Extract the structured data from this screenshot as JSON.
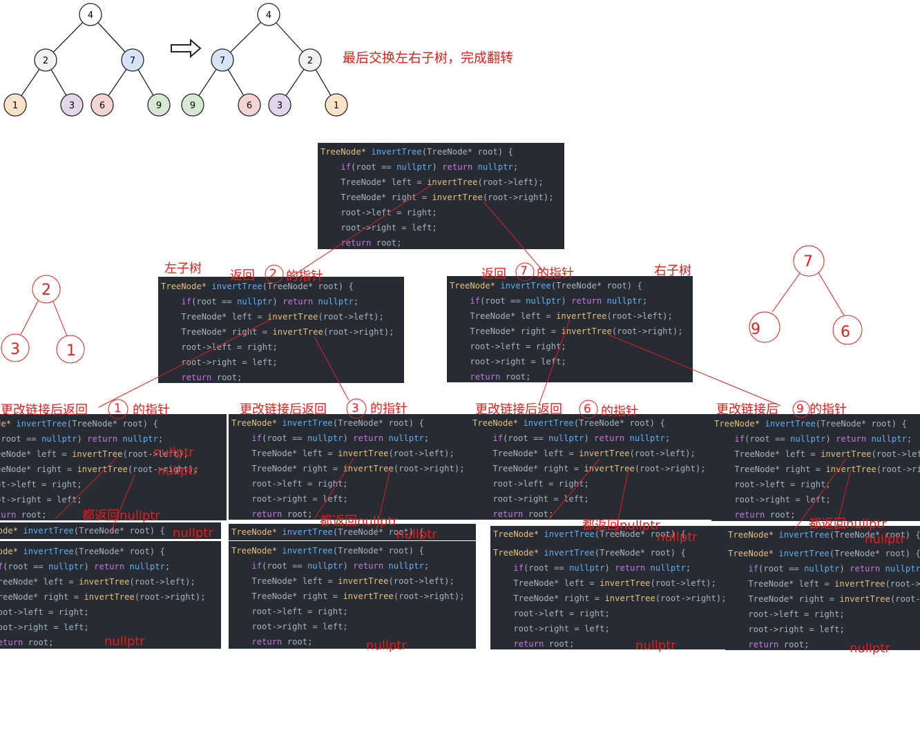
{
  "tree_before": {
    "root": "4",
    "left": "2",
    "right": "7",
    "ll": "1",
    "lr": "3",
    "rl": "6",
    "rr": "9"
  },
  "tree_after": {
    "root": "4",
    "left": "7",
    "right": "2",
    "ll": "9",
    "lr": "6",
    "rl": "3",
    "rr": "1"
  },
  "arrow_icon": "right-arrow-icon",
  "final_note": "最后交换左右子树，完成翻转",
  "code": {
    "l1": [
      "TreeNode* ",
      "invertTree",
      "(TreeNode* root) {"
    ],
    "l2": [
      "    ",
      "if",
      "(root == ",
      "nullptr",
      ") ",
      "return",
      " ",
      "nullptr",
      ";"
    ],
    "l3": [
      "    TreeNode* left = ",
      "invertTree",
      "(root->left);"
    ],
    "l4": [
      "    TreeNode* right = ",
      "invertTree",
      "(root->right);"
    ],
    "l5": "    root->left = right;",
    "l6": "    root->right = left;",
    "l7": [
      "    ",
      "return",
      " root;"
    ]
  },
  "labels": {
    "left_subtree": "左子树",
    "right_subtree": "右子树",
    "return_2": "返回",
    "return_7": "返回",
    "ptr_suffix": "的指针",
    "num_2": "2",
    "num_7": "7",
    "changed_return": "更改链接后返回",
    "changed_return_short": "更改链接后",
    "num_1": "1",
    "num_3": "3",
    "num_6": "6",
    "num_9": "9",
    "all_return_nullptr": "都返回nullptr",
    "nullptr": "nullptr"
  },
  "hand_tree_left": {
    "root": "2",
    "left": "3",
    "right": "1"
  },
  "hand_tree_right": {
    "root": "7",
    "left": "9",
    "right": "6"
  },
  "colors": {
    "red": "#e0211a",
    "code_bg": "#272b33",
    "node_1": "#fde3c8",
    "node_3": "#e3d5ea",
    "node_6": "#f7d4d4",
    "node_9": "#d5e9d3",
    "node_7": "#d7e4f7",
    "node_2": "#f2f2f2",
    "node_4": "#ffffff"
  }
}
